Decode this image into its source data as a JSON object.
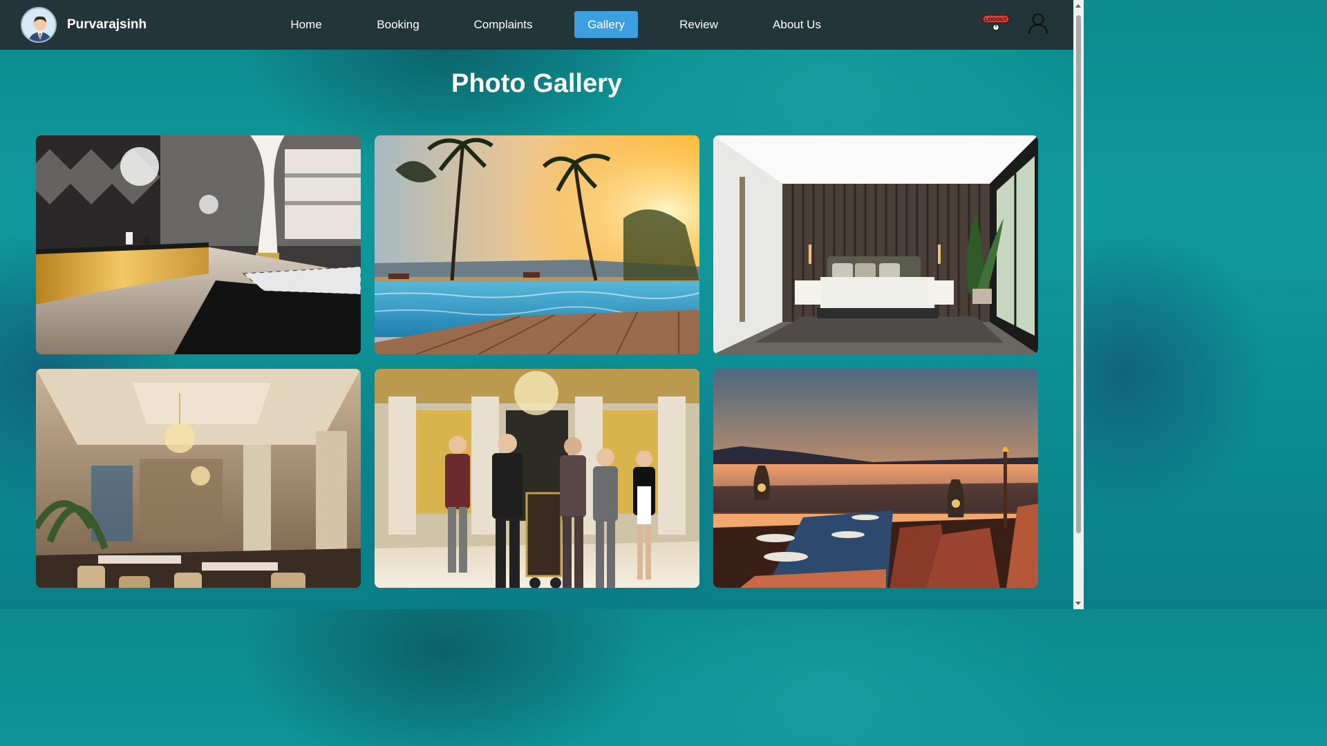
{
  "navbar": {
    "username": "Purvarajsinh",
    "links": [
      {
        "label": "Home"
      },
      {
        "label": "Booking"
      },
      {
        "label": "Complaints"
      },
      {
        "label": "Gallery",
        "active": true
      },
      {
        "label": "Review"
      },
      {
        "label": "About Us"
      }
    ],
    "logout_label": "LOGOUT",
    "active_color": "#3d9fe0"
  },
  "page": {
    "title": "Photo Gallery"
  },
  "gallery": {
    "photos": [
      {
        "subject": "hotel-lobby"
      },
      {
        "subject": "pool-sunset"
      },
      {
        "subject": "bedroom"
      },
      {
        "subject": "restaurant"
      },
      {
        "subject": "hotel-staff"
      },
      {
        "subject": "terrace-dining-sunset"
      }
    ]
  }
}
